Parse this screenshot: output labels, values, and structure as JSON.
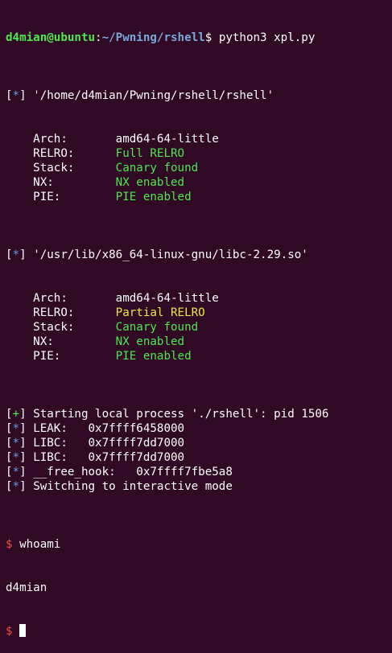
{
  "prompt": {
    "user_host": "d4mian@ubuntu",
    "colon": ":",
    "path": "~/Pwning/rshell",
    "symbol": "$",
    "command": "python3 xpl.py"
  },
  "binary": {
    "tag": "*",
    "path_line": "'/home/d4mian/Pwning/rshell/rshell'",
    "props": [
      {
        "key": "Arch:",
        "value": "amd64-64-little",
        "color": "#ffffff"
      },
      {
        "key": "RELRO:",
        "value": "Full RELRO",
        "color": "#4ee84e"
      },
      {
        "key": "Stack:",
        "value": "Canary found",
        "color": "#4ee84e"
      },
      {
        "key": "NX:",
        "value": "NX enabled",
        "color": "#4ee84e"
      },
      {
        "key": "PIE:",
        "value": "PIE enabled",
        "color": "#4ee84e"
      }
    ]
  },
  "libc": {
    "tag": "*",
    "path_line": "'/usr/lib/x86_64-linux-gnu/libc-2.29.so'",
    "props": [
      {
        "key": "Arch:",
        "value": "amd64-64-little",
        "color": "#ffffff"
      },
      {
        "key": "RELRO:",
        "value": "Partial RELRO",
        "color": "#e8e847"
      },
      {
        "key": "Stack:",
        "value": "Canary found",
        "color": "#4ee84e"
      },
      {
        "key": "NX:",
        "value": "NX enabled",
        "color": "#4ee84e"
      },
      {
        "key": "PIE:",
        "value": "PIE enabled",
        "color": "#4ee84e"
      }
    ]
  },
  "log": [
    {
      "tag": "+",
      "tag_color": "#4ee84e",
      "text": "Starting local process './rshell': pid 1506"
    },
    {
      "tag": "*",
      "tag_color": "#5f9ee8",
      "text": "LEAK:   0x7ffff6458000"
    },
    {
      "tag": "*",
      "tag_color": "#5f9ee8",
      "text": "LIBC:   0x7ffff7dd7000"
    },
    {
      "tag": "*",
      "tag_color": "#5f9ee8",
      "text": "LIBC:   0x7ffff7dd7000"
    },
    {
      "tag": "*",
      "tag_color": "#5f9ee8",
      "text": "__free_hook:   0x7ffff7fbe5a8"
    },
    {
      "tag": "*",
      "tag_color": "#5f9ee8",
      "text": "Switching to interactive mode"
    }
  ],
  "shell": {
    "symbol": "$",
    "command": "whoami",
    "output": "d4mian",
    "prompt_symbol": "$"
  },
  "colors": {
    "background": "#300a24",
    "prompt_user": "#4ee84e",
    "prompt_path": "#7aa6da",
    "tag_info": "#5f9ee8",
    "tag_success": "#4ee84e",
    "shell_prompt": "#f04b4b"
  }
}
